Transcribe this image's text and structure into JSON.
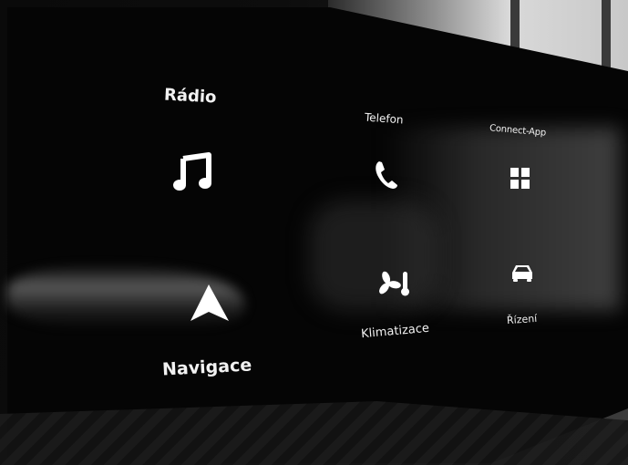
{
  "home_screen": {
    "tiles": [
      {
        "label": "Rádio",
        "icon": "music-note-icon"
      },
      {
        "label": "Telefon",
        "icon": "phone-icon"
      },
      {
        "label": "Connect-App",
        "icon": "grid-apps-icon"
      },
      {
        "label": "Navigace",
        "icon": "navigation-arrow-icon"
      },
      {
        "label": "Klimatizace",
        "icon": "fan-thermometer-icon"
      },
      {
        "label": "Řízení",
        "icon": "car-icon"
      }
    ]
  },
  "colors": {
    "screen_background": "#050505",
    "text": "#f2f2f2",
    "icon": "#ffffff"
  }
}
